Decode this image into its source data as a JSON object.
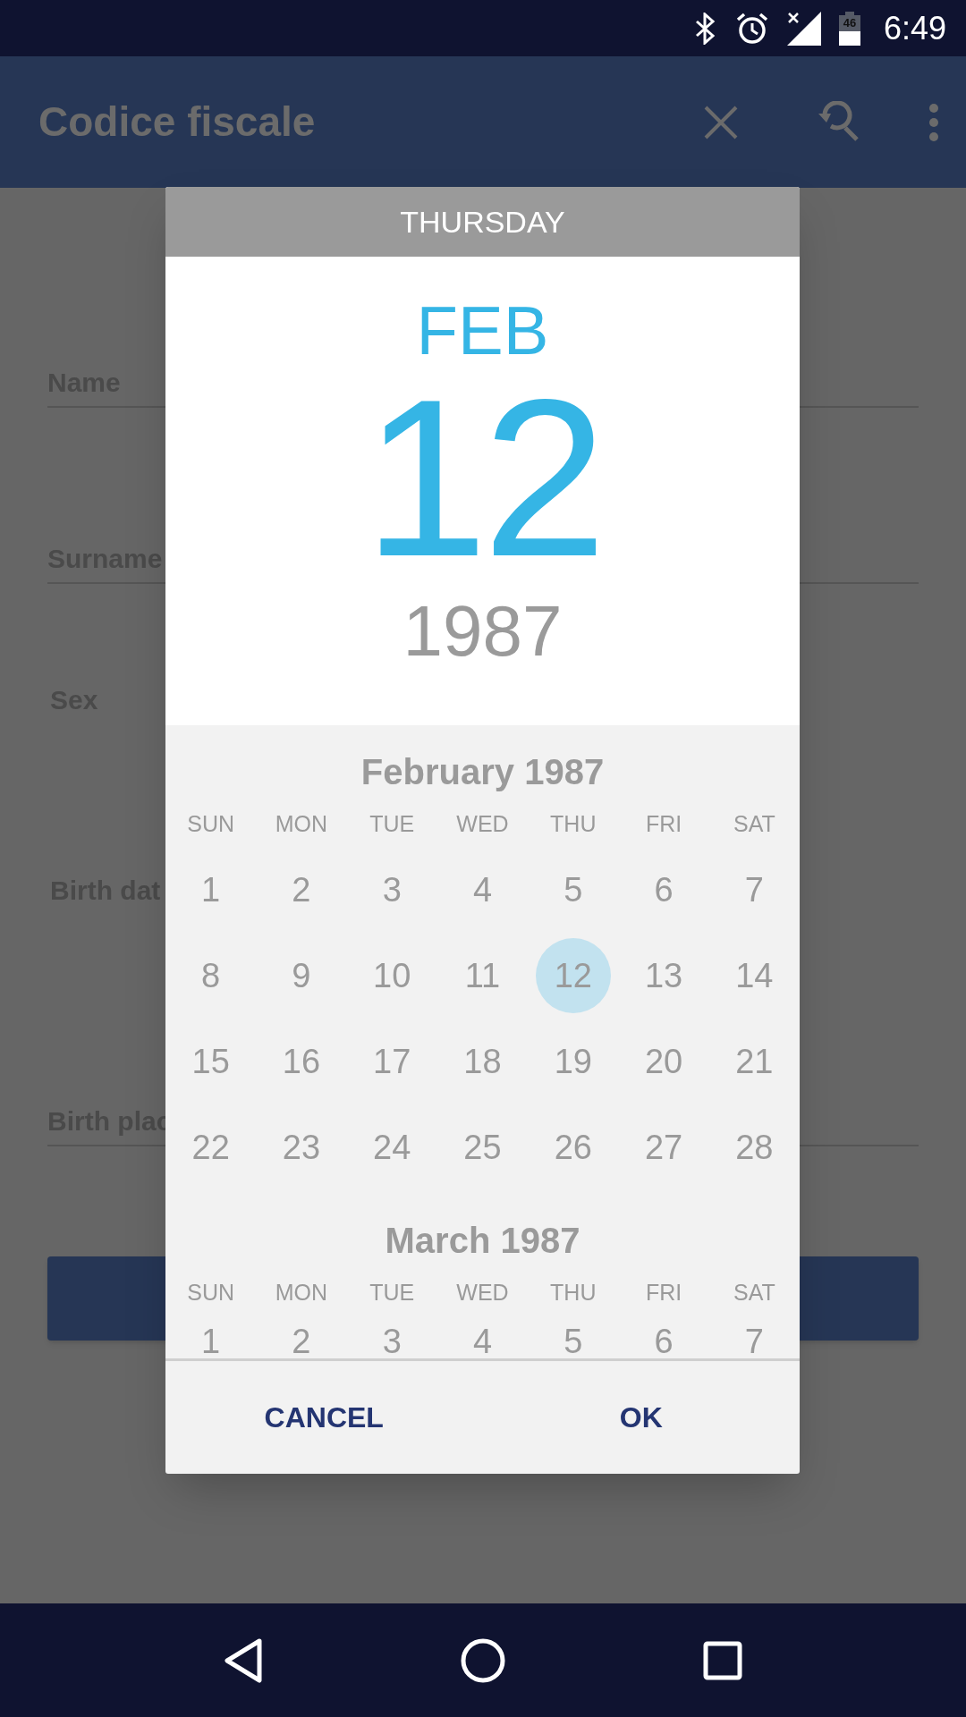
{
  "status_bar": {
    "battery": "46",
    "time": "6:49"
  },
  "app_bar": {
    "title": "Codice fiscale"
  },
  "form": {
    "fields": [
      {
        "label": "Name",
        "kind": "field"
      },
      {
        "label": "Surname",
        "kind": "field"
      },
      {
        "label": "Sex",
        "kind": "label"
      },
      {
        "label": "Birth dat",
        "kind": "label"
      },
      {
        "label": "Birth plac",
        "kind": "field"
      }
    ]
  },
  "dialog": {
    "weekday": "THURSDAY",
    "month": "FEB",
    "day": "12",
    "year": "1987",
    "months": [
      {
        "title": "February 1987",
        "weekdays": [
          "SUN",
          "MON",
          "TUE",
          "WED",
          "THU",
          "FRI",
          "SAT"
        ],
        "days": [
          {
            "label": "1",
            "selected": false
          },
          {
            "label": "2",
            "selected": false
          },
          {
            "label": "3",
            "selected": false
          },
          {
            "label": "4",
            "selected": false
          },
          {
            "label": "5",
            "selected": false
          },
          {
            "label": "6",
            "selected": false
          },
          {
            "label": "7",
            "selected": false
          },
          {
            "label": "8",
            "selected": false
          },
          {
            "label": "9",
            "selected": false
          },
          {
            "label": "10",
            "selected": false
          },
          {
            "label": "11",
            "selected": false
          },
          {
            "label": "12",
            "selected": true
          },
          {
            "label": "13",
            "selected": false
          },
          {
            "label": "14",
            "selected": false
          },
          {
            "label": "15",
            "selected": false
          },
          {
            "label": "16",
            "selected": false
          },
          {
            "label": "17",
            "selected": false
          },
          {
            "label": "18",
            "selected": false
          },
          {
            "label": "19",
            "selected": false
          },
          {
            "label": "20",
            "selected": false
          },
          {
            "label": "21",
            "selected": false
          },
          {
            "label": "22",
            "selected": false
          },
          {
            "label": "23",
            "selected": false
          },
          {
            "label": "24",
            "selected": false
          },
          {
            "label": "25",
            "selected": false
          },
          {
            "label": "26",
            "selected": false
          },
          {
            "label": "27",
            "selected": false
          },
          {
            "label": "28",
            "selected": false
          }
        ]
      },
      {
        "title": "March 1987",
        "weekdays": [
          "SUN",
          "MON",
          "TUE",
          "WED",
          "THU",
          "FRI",
          "SAT"
        ],
        "days": [
          {
            "label": "1",
            "selected": false
          },
          {
            "label": "2",
            "selected": false
          },
          {
            "label": "3",
            "selected": false
          },
          {
            "label": "4",
            "selected": false
          },
          {
            "label": "5",
            "selected": false
          },
          {
            "label": "6",
            "selected": false
          },
          {
            "label": "7",
            "selected": false
          }
        ]
      }
    ],
    "buttons": [
      "CANCEL",
      "OK"
    ]
  }
}
